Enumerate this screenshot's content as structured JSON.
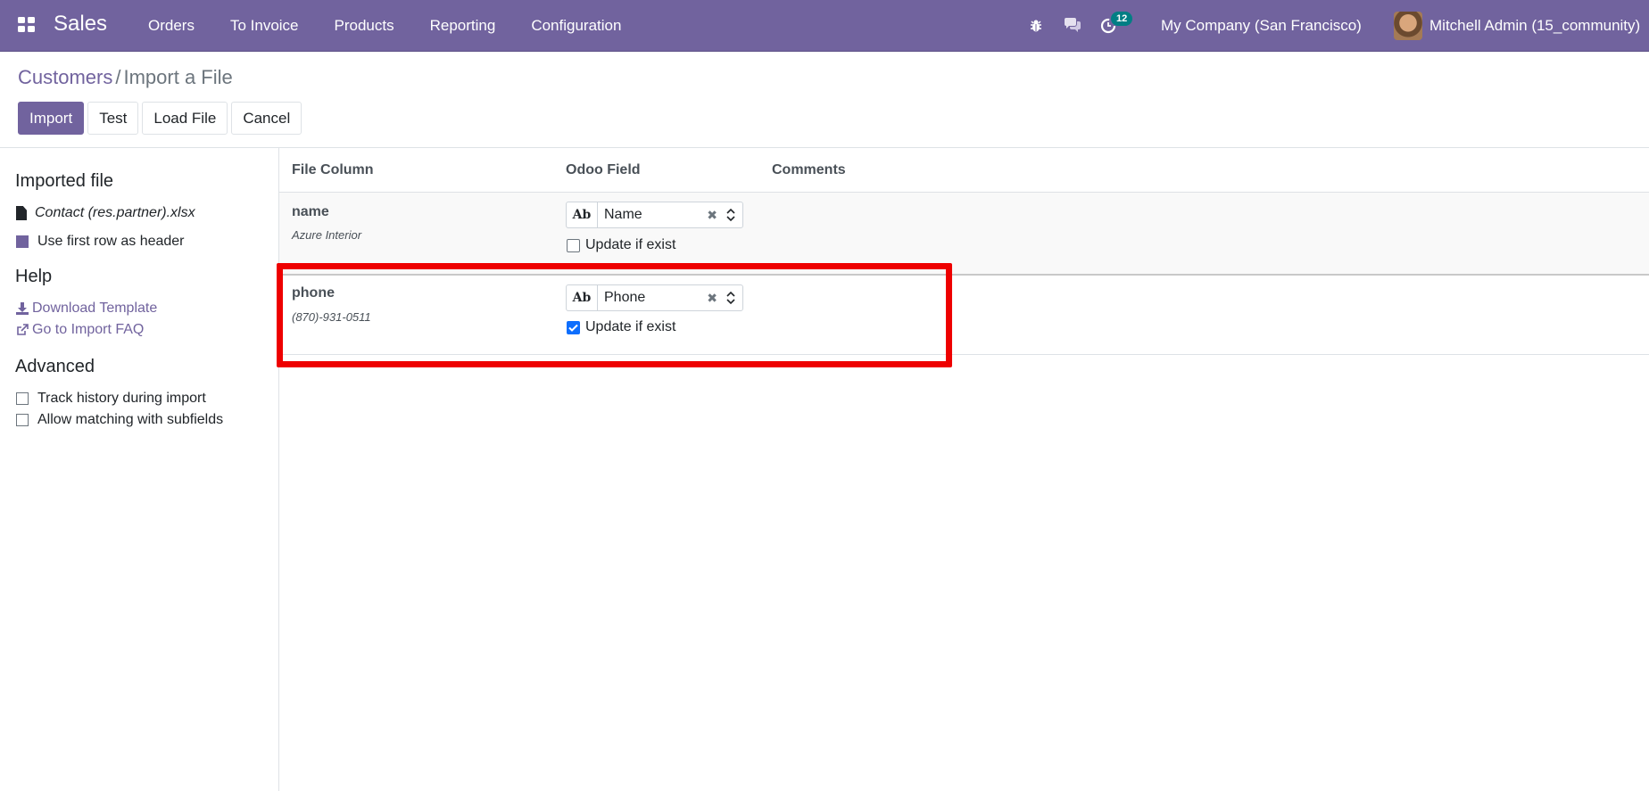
{
  "navbar": {
    "app_name": "Sales",
    "menu": [
      "Orders",
      "To Invoice",
      "Products",
      "Reporting",
      "Configuration"
    ],
    "activity_count": "12",
    "company": "My Company (San Francisco)",
    "user": "Mitchell Admin (15_community)",
    "icons": [
      "apps-grid-icon",
      "bug-icon",
      "chat-icon",
      "activity-clock-icon"
    ]
  },
  "breadcrumb": {
    "parent": "Customers",
    "separator": "/",
    "current": "Import a File"
  },
  "buttons": {
    "import": "Import",
    "test": "Test",
    "load_file": "Load File",
    "cancel": "Cancel"
  },
  "sidebar": {
    "imported_file_title": "Imported file",
    "file_name": "Contact (res.partner).xlsx",
    "first_row_header": "Use first row as header",
    "help_title": "Help",
    "download_template": "Download Template",
    "import_faq": "Go to Import FAQ",
    "advanced_title": "Advanced",
    "track_history": "Track history during import",
    "allow_subfields": "Allow matching with subfields"
  },
  "table": {
    "headers": {
      "file_column": "File Column",
      "odoo_field": "Odoo Field",
      "comments": "Comments"
    },
    "rows": [
      {
        "column": "name",
        "sample": "Azure Interior",
        "field": "Name",
        "field_type": "Ab",
        "update_label": "Update if exist",
        "update_checked": false
      },
      {
        "column": "phone",
        "sample": "(870)-931-0511",
        "field": "Phone",
        "field_type": "Ab",
        "update_label": "Update if exist",
        "update_checked": true
      }
    ]
  },
  "colors": {
    "brand": "#71639e",
    "highlight": "#ee0000",
    "checkbox": "#0d6efd",
    "badge": "#017e84"
  }
}
